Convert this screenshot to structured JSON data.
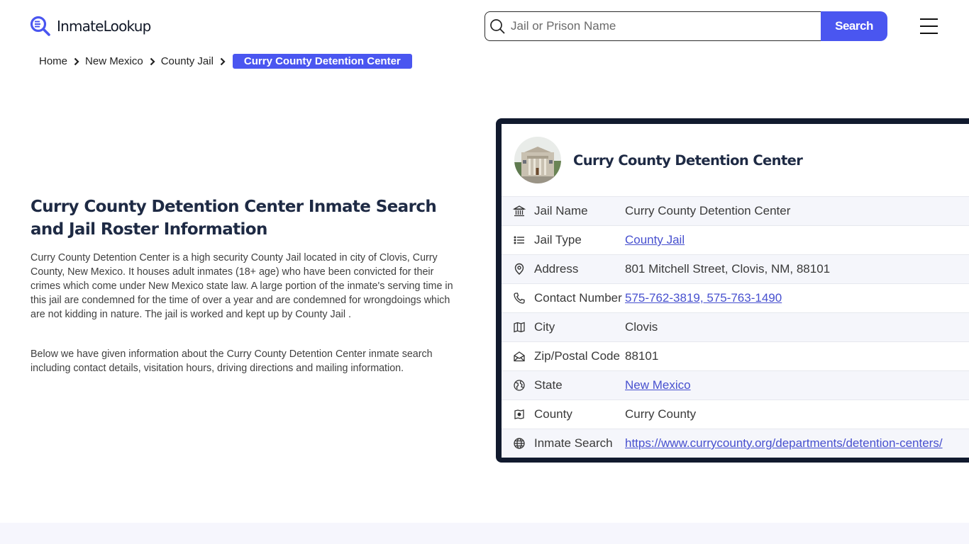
{
  "header": {
    "logo_text": "InmateLookup",
    "search": {
      "placeholder": "Jail or Prison Name",
      "value": "",
      "button_label": "Search"
    },
    "menu_icon": "hamburger-menu-icon"
  },
  "breadcrumb": {
    "items": [
      "Home",
      "New Mexico",
      "County Jail"
    ],
    "current": "Curry County Detention Center"
  },
  "main": {
    "title": "Curry County Detention Center Inmate Search and Jail Roster Information",
    "paragraphs": [
      "Curry County Detention Center is a high security County Jail located in city of Clovis, Curry County, New Mexico. It houses adult inmates (18+ age) who have been convicted for their crimes which come under New Mexico state law. A large portion of the inmate's serving time in this jail are condemned for the time of over a year and are condemned for wrongdoings which are not kidding in nature. The jail is worked and kept up by County Jail .",
      "Below we have given information about the Curry County Detention Center inmate search including contact details, visitation hours, driving directions and mailing information."
    ]
  },
  "card": {
    "title": "Curry County Detention Center",
    "rows": [
      {
        "icon": "bank-building-icon",
        "label": "Jail Name",
        "value": "Curry County Detention Center",
        "link": false
      },
      {
        "icon": "list-icon",
        "label": "Jail Type",
        "value": "County Jail",
        "link": true
      },
      {
        "icon": "map-pin-icon",
        "label": "Address",
        "value": "801 Mitchell Street, Clovis, NM, 88101",
        "link": false
      },
      {
        "icon": "phone-icon",
        "label": "Contact Number",
        "value": "575-762-3819, 575-763-1490",
        "link": true
      },
      {
        "icon": "map-icon",
        "label": "City",
        "value": "Clovis",
        "link": false
      },
      {
        "icon": "mail-open-icon",
        "label": "Zip/Postal Code",
        "value": "88101",
        "link": false
      },
      {
        "icon": "globe-region-icon",
        "label": "State",
        "value": "New Mexico",
        "link": true
      },
      {
        "icon": "county-map-icon",
        "label": "County",
        "value": "Curry County",
        "link": false
      },
      {
        "icon": "globe-icon",
        "label": "Inmate Search",
        "value": "https://www.currycounty.org/departments/detention-centers/",
        "link": true
      }
    ]
  },
  "colors": {
    "accent": "#4a56f0",
    "card_border": "#111a2e",
    "title": "#1e2a44",
    "link": "#4750cf"
  }
}
